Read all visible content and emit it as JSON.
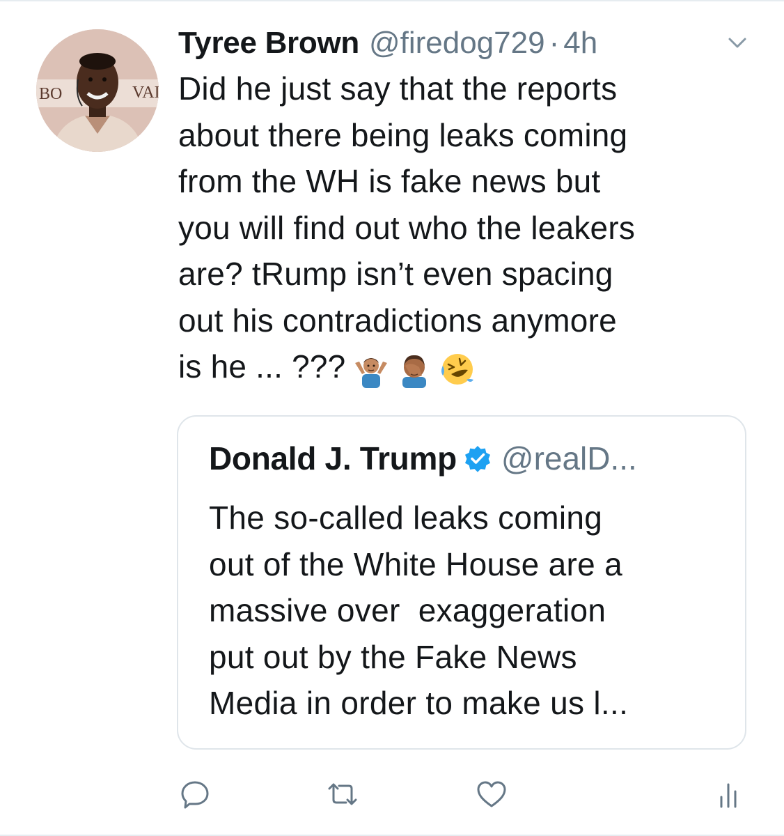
{
  "tweet": {
    "display_name": "Tyree Brown",
    "handle": "@firedog729",
    "separator": "·",
    "time": "4h",
    "avatar_sign_left": "BO",
    "avatar_sign_right": "VAI",
    "text_lines": [
      "Did he just say that the reports",
      "about there being leaks coming",
      "from the WH is fake news but",
      "you will find out who the leakers",
      "are? tRump isn’t even spacing",
      "out his contradictions anymore",
      "is he ... ???"
    ],
    "emojis": [
      "person-shrugging-icon",
      "person-facepalming-icon",
      "rolling-on-floor-laughing-icon"
    ]
  },
  "quoted_tweet": {
    "display_name": "Donald J. Trump",
    "verified": true,
    "handle": "@realD...",
    "text_lines": [
      "The so-called leaks coming",
      "out of the White House are a",
      "massive over  exaggeration",
      "put out by the Fake News",
      "Media in order to make us l..."
    ]
  },
  "actions": [
    {
      "name": "reply-icon"
    },
    {
      "name": "retweet-icon"
    },
    {
      "name": "like-icon"
    },
    {
      "name": "analytics-icon"
    }
  ],
  "colors": {
    "text": "#14171a",
    "secondary": "#657786",
    "border": "#e6ecf0",
    "verified": "#1da1f2"
  }
}
